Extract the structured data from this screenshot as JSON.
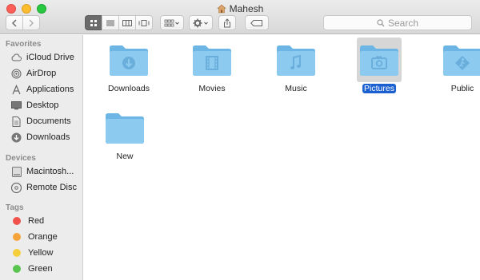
{
  "window": {
    "title": "Mahesh",
    "title_icon": "home-icon"
  },
  "toolbar": {
    "back_icon": "chevron-left-icon",
    "forward_icon": "chevron-right-icon",
    "views": [
      "icon-view-icon",
      "list-view-icon",
      "column-view-icon",
      "cover-flow-icon"
    ],
    "active_view": 0,
    "arrange_icon": "arrange-grid-icon",
    "action_icon": "gear-icon",
    "share_icon": "share-icon",
    "tag_icon": "tag-icon",
    "search_placeholder": "Search"
  },
  "sidebar": {
    "favorites_header": "Favorites",
    "favorites": [
      {
        "label": "iCloud Drive",
        "icon": "cloud-icon"
      },
      {
        "label": "AirDrop",
        "icon": "airdrop-icon"
      },
      {
        "label": "Applications",
        "icon": "applications-icon"
      },
      {
        "label": "Desktop",
        "icon": "desktop-icon"
      },
      {
        "label": "Documents",
        "icon": "documents-icon"
      },
      {
        "label": "Downloads",
        "icon": "downloads-icon"
      }
    ],
    "devices_header": "Devices",
    "devices": [
      {
        "label": "Macintosh...",
        "icon": "hard-drive-icon"
      },
      {
        "label": "Remote Disc",
        "icon": "disc-icon"
      }
    ],
    "tags_header": "Tags",
    "tags": [
      {
        "label": "Red",
        "color": "#f0524b"
      },
      {
        "label": "Orange",
        "color": "#f5a33a"
      },
      {
        "label": "Yellow",
        "color": "#f4cf3b"
      },
      {
        "label": "Green",
        "color": "#5ac451"
      }
    ]
  },
  "files": [
    {
      "name": "Downloads",
      "icon": "downloads-folder-icon",
      "selected": false
    },
    {
      "name": "Movies",
      "icon": "movies-folder-icon",
      "selected": false
    },
    {
      "name": "Music",
      "icon": "music-folder-icon",
      "selected": false
    },
    {
      "name": "Pictures",
      "icon": "pictures-folder-icon",
      "selected": true
    },
    {
      "name": "Public",
      "icon": "public-folder-icon",
      "selected": false
    },
    {
      "name": "New",
      "icon": "folder-icon",
      "selected": false
    }
  ],
  "colors": {
    "folder": "#8ccaf0",
    "folder_dark": "#6cb5e5",
    "selection": "#1b5fd0"
  }
}
